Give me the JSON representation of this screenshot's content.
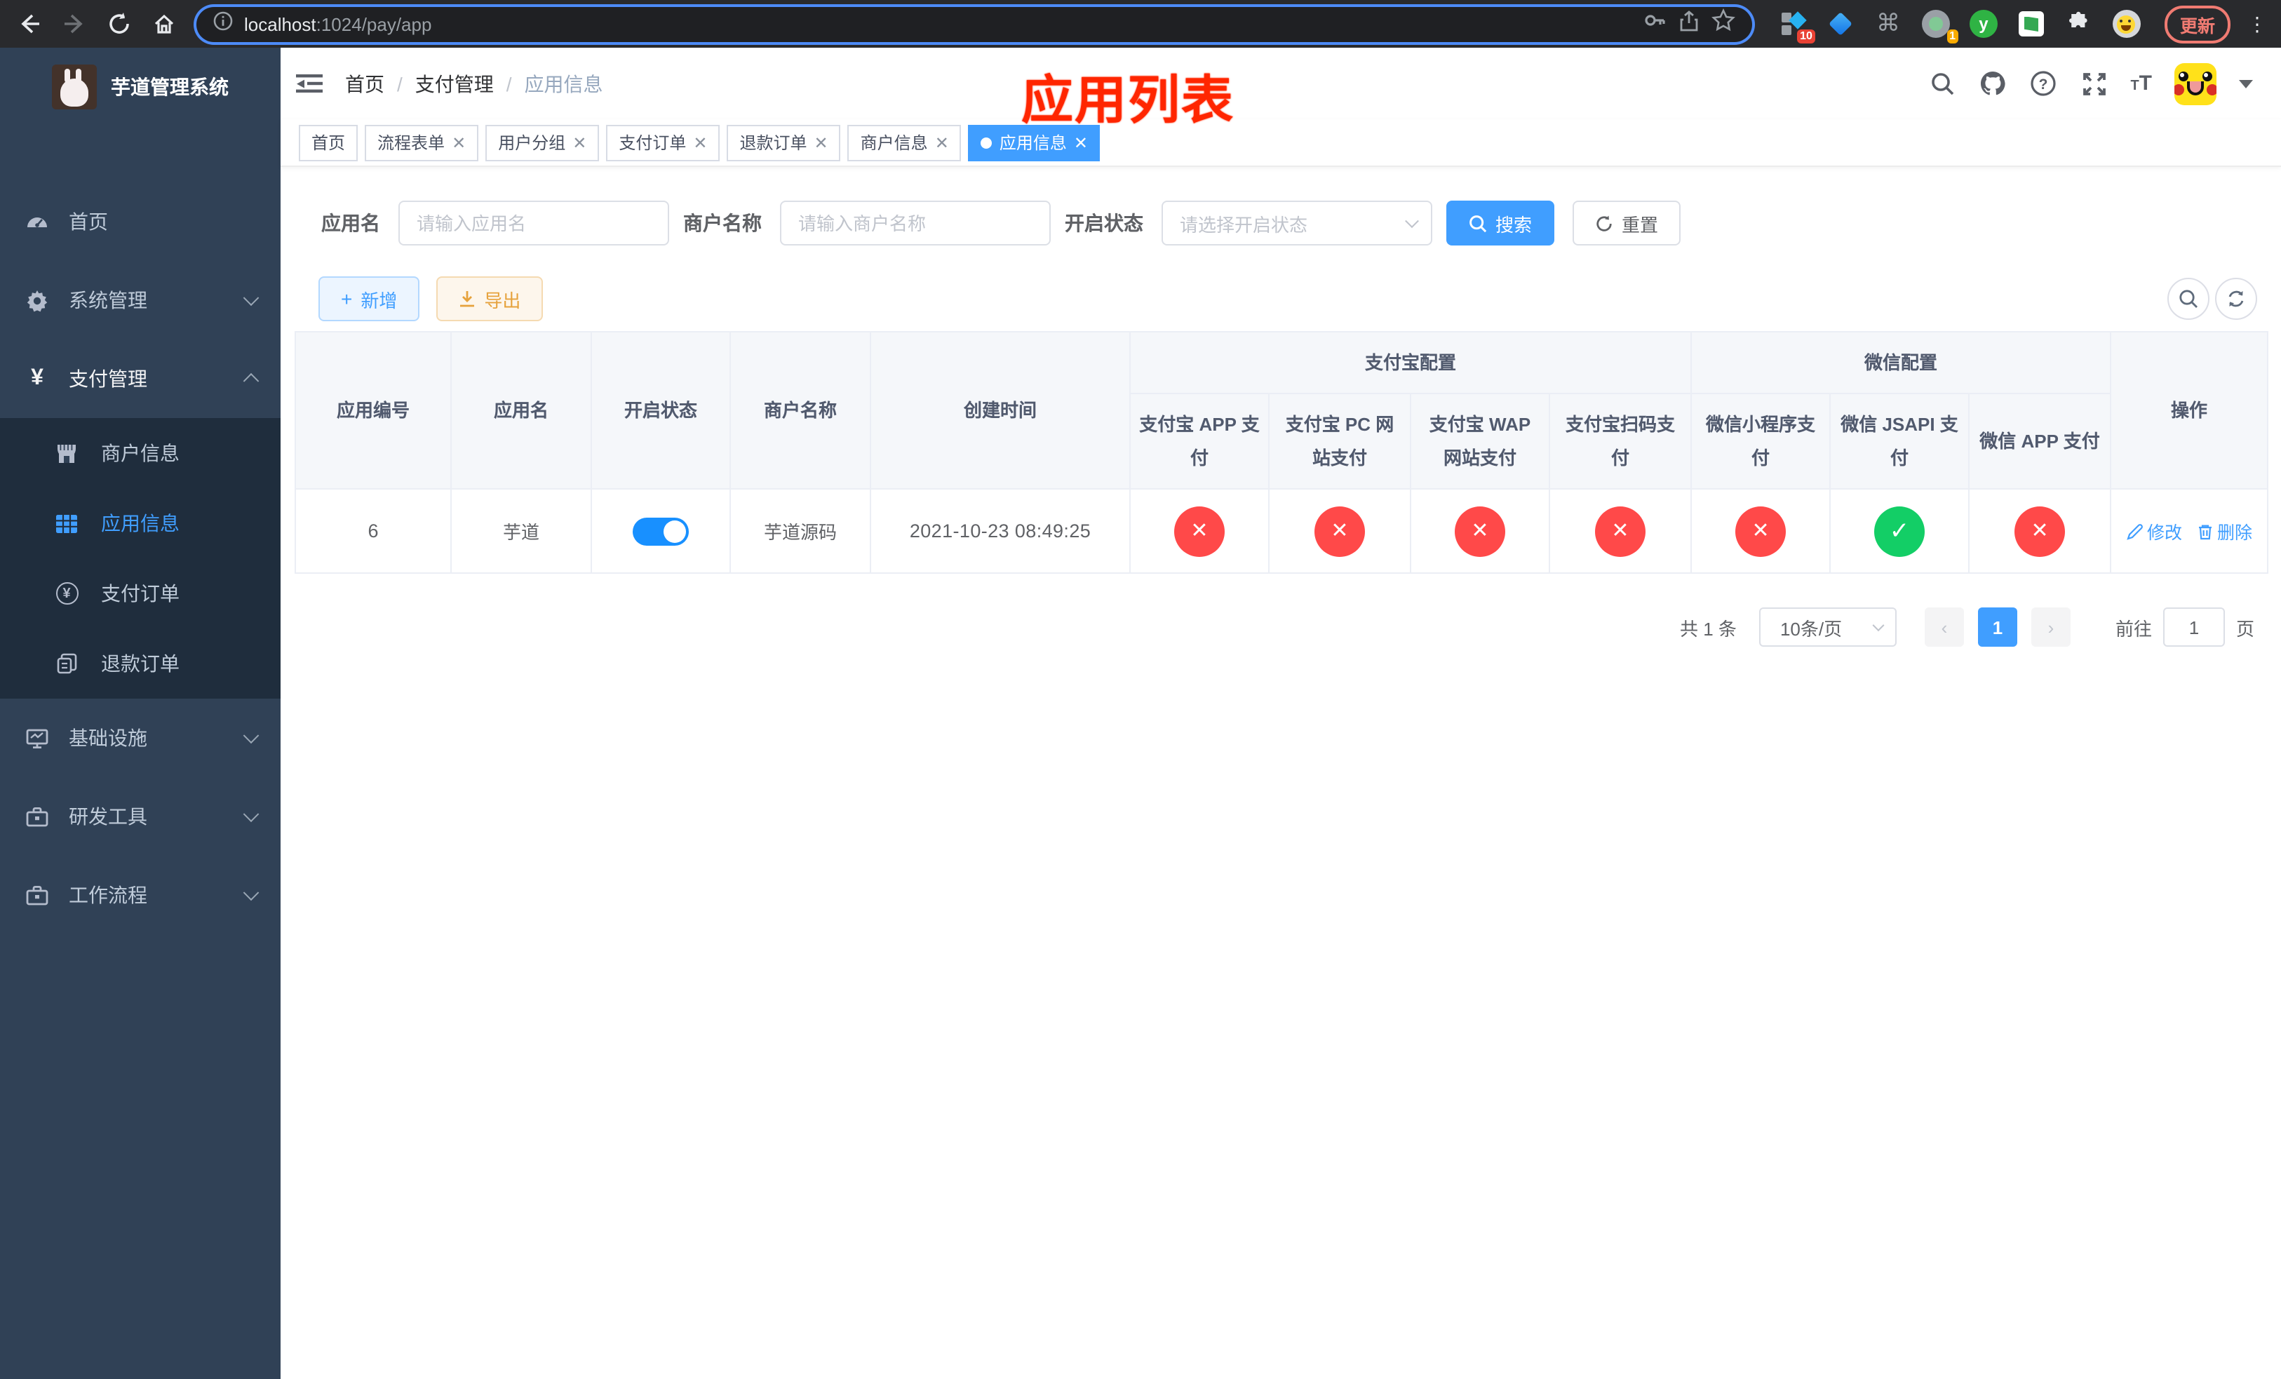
{
  "browser": {
    "url_host": "localhost",
    "url_rest": ":1024/pay/app",
    "update_label": "更新",
    "ext_badge_blocks": "10",
    "ext_badge_cam": "1",
    "ext_y_label": "y"
  },
  "sidebar": {
    "title": "芋道管理系统",
    "items": [
      {
        "label": "首页",
        "icon": "dashboard-icon"
      },
      {
        "label": "系统管理",
        "icon": "gear-icon"
      },
      {
        "label": "支付管理",
        "icon": "yen-icon"
      },
      {
        "label": "基础设施",
        "icon": "monitor-icon"
      },
      {
        "label": "研发工具",
        "icon": "toolbox-icon"
      },
      {
        "label": "工作流程",
        "icon": "toolbox-icon"
      }
    ],
    "submenu": [
      {
        "label": "商户信息",
        "icon": "store-icon"
      },
      {
        "label": "应用信息",
        "icon": "grid-icon"
      },
      {
        "label": "支付订单",
        "icon": "yen-circle-icon"
      },
      {
        "label": "退款订单",
        "icon": "document-icon"
      }
    ]
  },
  "navbar": {
    "breadcrumb": [
      "首页",
      "支付管理",
      "应用信息"
    ]
  },
  "annotation": "应用列表",
  "tabs": [
    {
      "label": "首页",
      "closable": false,
      "active": false
    },
    {
      "label": "流程表单",
      "closable": true,
      "active": false
    },
    {
      "label": "用户分组",
      "closable": true,
      "active": false
    },
    {
      "label": "支付订单",
      "closable": true,
      "active": false
    },
    {
      "label": "退款订单",
      "closable": true,
      "active": false
    },
    {
      "label": "商户信息",
      "closable": true,
      "active": false
    },
    {
      "label": "应用信息",
      "closable": true,
      "active": true
    }
  ],
  "filters": {
    "app_name_label": "应用名",
    "app_name_placeholder": "请输入应用名",
    "merchant_label": "商户名称",
    "merchant_placeholder": "请输入商户名称",
    "status_label": "开启状态",
    "status_placeholder": "请选择开启状态",
    "search_label": "搜索",
    "reset_label": "重置"
  },
  "toolbar": {
    "add_label": "新增",
    "export_label": "导出"
  },
  "table": {
    "group_headers": {
      "alipay": "支付宝配置",
      "wechat": "微信配置"
    },
    "columns": [
      "应用编号",
      "应用名",
      "开启状态",
      "商户名称",
      "创建时间",
      "支付宝 APP 支付",
      "支付宝 PC 网站支付",
      "支付宝 WAP 网站支付",
      "支付宝扫码支付",
      "微信小程序支付",
      "微信 JSAPI 支付",
      "微信 APP 支付",
      "操作"
    ],
    "row": {
      "id": "6",
      "name": "芋道",
      "enabled": true,
      "merchant": "芋道源码",
      "created_at": "2021-10-23 08:49:25",
      "channels": [
        "disabled",
        "disabled",
        "disabled",
        "disabled",
        "disabled",
        "enabled",
        "disabled"
      ],
      "edit_label": "修改",
      "delete_label": "删除"
    }
  },
  "pagination": {
    "total_text": "共 1 条",
    "page_size": "10条/页",
    "current_page": "1",
    "goto_label": "前往",
    "goto_value": "1",
    "page_suffix": "页"
  }
}
